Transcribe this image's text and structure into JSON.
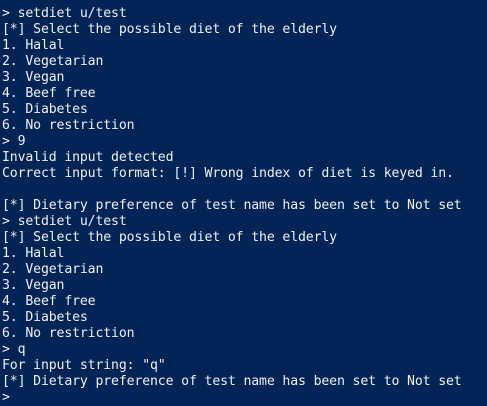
{
  "console": {
    "lines": [
      "> setdiet u/test",
      "[*] Select the possible diet of the elderly",
      "1. Halal",
      "2. Vegetarian",
      "3. Vegan",
      "4. Beef free",
      "5. Diabetes",
      "6. No restriction",
      "> 9",
      "Invalid input detected",
      "Correct input format: [!] Wrong index of diet is keyed in.",
      "",
      "[*] Dietary preference of test name has been set to Not set",
      "> setdiet u/test",
      "[*] Select the possible diet of the elderly",
      "1. Halal",
      "2. Vegetarian",
      "3. Vegan",
      "4. Beef free",
      "5. Diabetes",
      "6. No restriction",
      "> q",
      "For input string: \"q\"",
      "[*] Dietary preference of test name has been set to Not set",
      ">"
    ]
  }
}
